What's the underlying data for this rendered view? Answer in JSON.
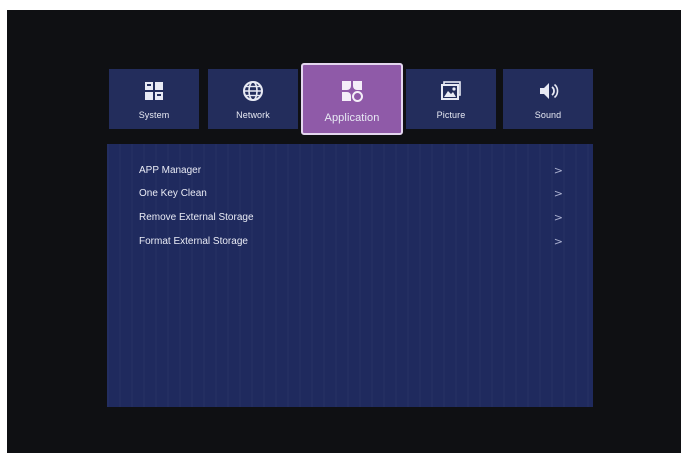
{
  "tabs": [
    {
      "id": "system",
      "label": "System",
      "icon": "system-grid-icon"
    },
    {
      "id": "network",
      "label": "Network",
      "icon": "globe-icon"
    },
    {
      "id": "application",
      "label": "Application",
      "icon": "clover-apps-icon",
      "active": true
    },
    {
      "id": "picture",
      "label": "Picture",
      "icon": "picture-icon"
    },
    {
      "id": "sound",
      "label": "Sound",
      "icon": "speaker-icon"
    }
  ],
  "menu": {
    "items": [
      {
        "label": "APP Manager",
        "chevron": ">"
      },
      {
        "label": "One Key Clean",
        "chevron": ">"
      },
      {
        "label": "Remove External Storage",
        "chevron": ">"
      },
      {
        "label": "Format External Storage",
        "chevron": ">"
      }
    ]
  },
  "colors": {
    "tab_bg": "#232d5c",
    "tab_active_bg": "#8f5aa8",
    "panel_bg": "#1f2a5e",
    "screen_bg": "#0f1013"
  }
}
